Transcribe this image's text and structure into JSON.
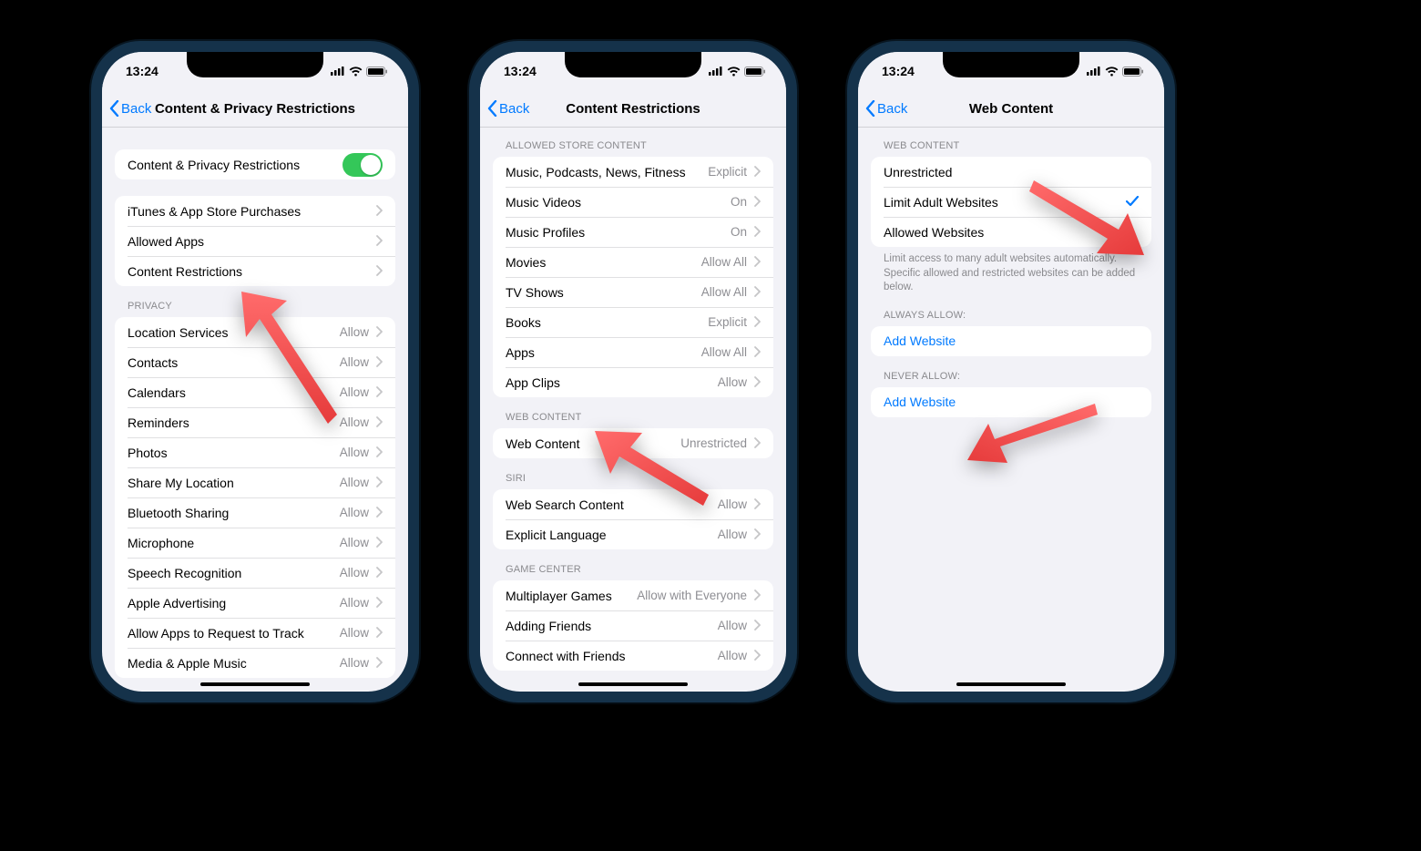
{
  "status_time": "13:24",
  "back_label": "Back",
  "phone1": {
    "title": "Content & Privacy Restrictions",
    "toggle_row_label": "Content & Privacy Restrictions",
    "rows1": [
      {
        "label": "iTunes & App Store Purchases"
      },
      {
        "label": "Allowed Apps"
      },
      {
        "label": "Content Restrictions"
      }
    ],
    "section_privacy": "Privacy",
    "rows_privacy": [
      {
        "label": "Location Services",
        "value": "Allow"
      },
      {
        "label": "Contacts",
        "value": "Allow"
      },
      {
        "label": "Calendars",
        "value": "Allow"
      },
      {
        "label": "Reminders",
        "value": "Allow"
      },
      {
        "label": "Photos",
        "value": "Allow"
      },
      {
        "label": "Share My Location",
        "value": "Allow"
      },
      {
        "label": "Bluetooth Sharing",
        "value": "Allow"
      },
      {
        "label": "Microphone",
        "value": "Allow"
      },
      {
        "label": "Speech Recognition",
        "value": "Allow"
      },
      {
        "label": "Apple Advertising",
        "value": "Allow"
      },
      {
        "label": "Allow Apps to Request to Track",
        "value": "Allow"
      },
      {
        "label": "Media & Apple Music",
        "value": "Allow"
      }
    ]
  },
  "phone2": {
    "title": "Content Restrictions",
    "section_store": "Allowed Store Content",
    "rows_store": [
      {
        "label": "Music, Podcasts, News, Fitness",
        "value": "Explicit"
      },
      {
        "label": "Music Videos",
        "value": "On"
      },
      {
        "label": "Music Profiles",
        "value": "On"
      },
      {
        "label": "Movies",
        "value": "Allow All"
      },
      {
        "label": "TV Shows",
        "value": "Allow All"
      },
      {
        "label": "Books",
        "value": "Explicit"
      },
      {
        "label": "Apps",
        "value": "Allow All"
      },
      {
        "label": "App Clips",
        "value": "Allow"
      }
    ],
    "section_web": "Web Content",
    "rows_web": [
      {
        "label": "Web Content",
        "value": "Unrestricted"
      }
    ],
    "section_siri": "Siri",
    "rows_siri": [
      {
        "label": "Web Search Content",
        "value": "Allow"
      },
      {
        "label": "Explicit Language",
        "value": "Allow"
      }
    ],
    "section_gc": "Game Center",
    "rows_gc": [
      {
        "label": "Multiplayer Games",
        "value": "Allow with Everyone"
      },
      {
        "label": "Adding Friends",
        "value": "Allow"
      },
      {
        "label": "Connect with Friends",
        "value": "Allow"
      }
    ]
  },
  "phone3": {
    "title": "Web Content",
    "section_wc": "Web Content",
    "rows_wc": [
      {
        "label": "Unrestricted",
        "checked": false
      },
      {
        "label": "Limit Adult Websites",
        "checked": true
      },
      {
        "label": "Allowed Websites",
        "checked": false
      }
    ],
    "footer": "Limit access to many adult websites automatically. Specific allowed and restricted websites can be added below.",
    "section_always": "Always Allow:",
    "add_website": "Add Website",
    "section_never": "Never Allow:"
  }
}
